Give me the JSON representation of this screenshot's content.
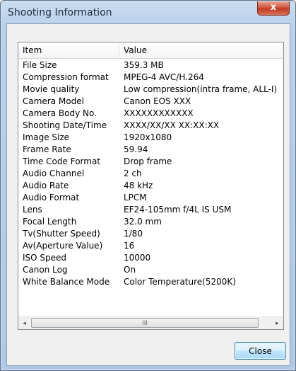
{
  "window": {
    "title": "Shooting Information",
    "close_glyph": "x"
  },
  "table": {
    "headers": [
      "Item",
      "Value"
    ],
    "rows": [
      [
        "File Size",
        "359.3 MB"
      ],
      [
        "Compression format",
        "MPEG-4 AVC/H.264"
      ],
      [
        "Movie quality",
        "Low compression(intra frame, ALL-I)"
      ],
      [
        "Camera Model",
        "Canon EOS XXX"
      ],
      [
        "Camera Body No.",
        "XXXXXXXXXXXX"
      ],
      [
        "Shooting Date/Time",
        "XXXX/XX/XX XX:XX:XX"
      ],
      [
        "Image Size",
        "1920x1080"
      ],
      [
        "Frame Rate",
        "59.94"
      ],
      [
        "Time Code Format",
        "Drop frame"
      ],
      [
        "Audio Channel",
        "2 ch"
      ],
      [
        "Audio Rate",
        "48 kHz"
      ],
      [
        "Audio Format",
        "LPCM"
      ],
      [
        "Lens",
        "EF24-105mm f/4L IS USM"
      ],
      [
        "Focal Length",
        "32.0 mm"
      ],
      [
        "Tv(Shutter Speed)",
        "1/80"
      ],
      [
        "Av(Aperture Value)",
        "16"
      ],
      [
        "ISO Speed",
        "10000"
      ],
      [
        "Canon Log",
        "On"
      ],
      [
        "White Balance Mode",
        "Color Temperature(5200K)"
      ]
    ]
  },
  "scrollbar": {
    "left_arrow": "◂",
    "right_arrow": "▸",
    "thumb_grip": "III"
  },
  "buttons": {
    "close_label": "Close"
  }
}
